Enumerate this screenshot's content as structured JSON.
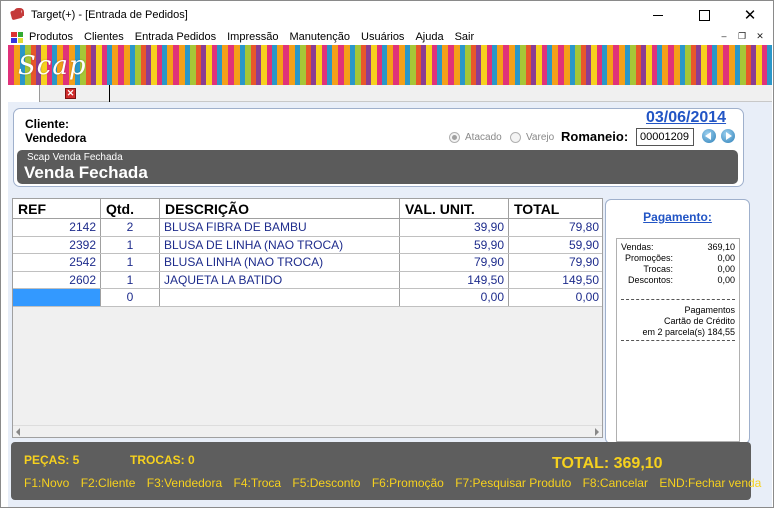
{
  "window": {
    "title": "Target(+) - [Entrada de Pedidos]"
  },
  "menu": [
    "Produtos",
    "Clientes",
    "Entrada Pedidos",
    "Impressão",
    "Manutenção",
    "Usuários",
    "Ajuda",
    "Sair"
  ],
  "banner": {
    "logo": "Scap"
  },
  "header": {
    "cliente_label": "Cliente:",
    "vendedora_label": "Vendedora",
    "date": "03/06/2014",
    "atacado_label": "Atacado",
    "varejo_label": "Varejo",
    "romaneio_label": "Romaneio:",
    "romaneio_value": "00001209"
  },
  "status": {
    "small": "Scap Venda Fechada",
    "big": "Venda Fechada"
  },
  "grid": {
    "headers": [
      "REF",
      "Qtd.",
      "DESCRIÇÃO",
      "VAL. UNIT.",
      "TOTAL"
    ],
    "rows": [
      {
        "ref": "2142",
        "qtd": "2",
        "desc": "BLUSA FIBRA DE BAMBU",
        "val": "39,90",
        "tot": "79,80"
      },
      {
        "ref": "2392",
        "qtd": "1",
        "desc": "BLUSA DE LINHA (NAO TROCA)",
        "val": "59,90",
        "tot": "59,90"
      },
      {
        "ref": "2542",
        "qtd": "1",
        "desc": "BLUSA LINHA (NAO TROCA)",
        "val": "79,90",
        "tot": "79,90"
      },
      {
        "ref": "2602",
        "qtd": "1",
        "desc": "JAQUETA LA BATIDO",
        "val": "149,50",
        "tot": "149,50"
      },
      {
        "ref": "",
        "qtd": "0",
        "desc": "",
        "val": "0,00",
        "tot": "0,00"
      }
    ]
  },
  "payment": {
    "title": "Pagamento:",
    "vendas_label": "Vendas:",
    "vendas": "369,10",
    "promocoes_label": "Promoções:",
    "promocoes": "0,00",
    "trocas_label": "Trocas:",
    "trocas": "0,00",
    "descontos_label": "Descontos:",
    "descontos": "0,00",
    "line1": "Pagamentos",
    "line2": "Cartão de Crédito",
    "line3": "em 2 parcela(s) 184,55"
  },
  "footer": {
    "pecas": "PEÇAS:  5",
    "trocas": "TROCAS:  0",
    "total": "TOTAL:  369,10",
    "keys": [
      "F1:Novo",
      "F2:Cliente",
      "F3:Vendedora",
      "F4:Troca",
      "F5:Desconto",
      "F6:Promoção",
      "F7:Pesquisar Produto",
      "F8:Cancelar",
      "END:Fechar venda"
    ]
  },
  "colors": {
    "accent_blue": "#2255c5",
    "footer_text": "#f6d11e",
    "dark_panel": "#5e5e5e",
    "grid_text": "#1e2c8c",
    "selected_cell": "#3399ff"
  }
}
